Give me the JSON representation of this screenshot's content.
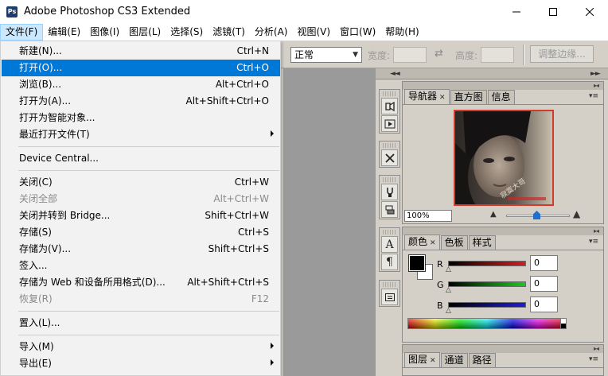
{
  "window": {
    "title": "Adobe Photoshop CS3 Extended",
    "icon_text": "Ps"
  },
  "menubar": {
    "items": [
      "文件(F)",
      "编辑(E)",
      "图像(I)",
      "图层(L)",
      "选择(S)",
      "滤镜(T)",
      "分析(A)",
      "视图(V)",
      "窗口(W)",
      "帮助(H)"
    ],
    "active_index": 0
  },
  "options": {
    "mode_value": "正常",
    "width_label": "宽度:",
    "height_label": "高度:",
    "refine_label": "调整边缘..."
  },
  "dock": {
    "left_arrows": "◄◄",
    "right_arrows": "►►"
  },
  "toolstrip": {
    "icons": [
      "history-brush-icon",
      "action-play-icon",
      "tools-icon",
      "clone-source-icon",
      "layer-comps-icon",
      "character-icon",
      "paragraph-icon",
      "notes-icon"
    ]
  },
  "navigator": {
    "tabs": [
      {
        "label": "导航器",
        "active": true,
        "closable": true
      },
      {
        "label": "直方图",
        "active": false,
        "closable": false
      },
      {
        "label": "信息",
        "active": false,
        "closable": false
      }
    ],
    "zoom": "100%",
    "thumb_watermark": "寂寞大哥"
  },
  "color_panel": {
    "tabs": [
      {
        "label": "颜色",
        "active": true,
        "closable": true
      },
      {
        "label": "色板",
        "active": false,
        "closable": false
      },
      {
        "label": "样式",
        "active": false,
        "closable": false
      }
    ],
    "channels": [
      {
        "label": "R",
        "value": "0",
        "color": "#d21e1e"
      },
      {
        "label": "G",
        "value": "0",
        "color": "#1ec81e"
      },
      {
        "label": "B",
        "value": "0",
        "color": "#1e1ed2"
      }
    ],
    "foreground": "#000000",
    "background": "#ffffff"
  },
  "layers_panel": {
    "tabs": [
      {
        "label": "图层",
        "active": true,
        "closable": true
      },
      {
        "label": "通道",
        "active": false,
        "closable": false
      },
      {
        "label": "路径",
        "active": false,
        "closable": false
      }
    ]
  },
  "file_menu": {
    "items": [
      {
        "label": "新建(N)...",
        "shortcut": "Ctrl+N",
        "enabled": true,
        "highlighted": false,
        "submenu": false
      },
      {
        "label": "打开(O)...",
        "shortcut": "Ctrl+O",
        "enabled": true,
        "highlighted": true,
        "submenu": false
      },
      {
        "label": "浏览(B)...",
        "shortcut": "Alt+Ctrl+O",
        "enabled": true,
        "highlighted": false,
        "submenu": false
      },
      {
        "label": "打开为(A)...",
        "shortcut": "Alt+Shift+Ctrl+O",
        "enabled": true,
        "highlighted": false,
        "submenu": false
      },
      {
        "label": "打开为智能对象...",
        "shortcut": "",
        "enabled": true,
        "highlighted": false,
        "submenu": false
      },
      {
        "label": "最近打开文件(T)",
        "shortcut": "",
        "enabled": true,
        "highlighted": false,
        "submenu": true
      },
      {
        "separator": true
      },
      {
        "label": "Device Central...",
        "shortcut": "",
        "enabled": true,
        "highlighted": false,
        "submenu": false
      },
      {
        "separator": true
      },
      {
        "label": "关闭(C)",
        "shortcut": "Ctrl+W",
        "enabled": true,
        "highlighted": false,
        "submenu": false
      },
      {
        "label": "关闭全部",
        "shortcut": "Alt+Ctrl+W",
        "enabled": false,
        "highlighted": false,
        "submenu": false
      },
      {
        "label": "关闭并转到 Bridge...",
        "shortcut": "Shift+Ctrl+W",
        "enabled": true,
        "highlighted": false,
        "submenu": false
      },
      {
        "label": "存储(S)",
        "shortcut": "Ctrl+S",
        "enabled": true,
        "highlighted": false,
        "submenu": false
      },
      {
        "label": "存储为(V)...",
        "shortcut": "Shift+Ctrl+S",
        "enabled": true,
        "highlighted": false,
        "submenu": false
      },
      {
        "label": "签入...",
        "shortcut": "",
        "enabled": true,
        "highlighted": false,
        "submenu": false
      },
      {
        "label": "存储为 Web 和设备所用格式(D)...",
        "shortcut": "Alt+Shift+Ctrl+S",
        "enabled": true,
        "highlighted": false,
        "submenu": false
      },
      {
        "label": "恢复(R)",
        "shortcut": "F12",
        "enabled": false,
        "highlighted": false,
        "submenu": false
      },
      {
        "separator": true
      },
      {
        "label": "置入(L)...",
        "shortcut": "",
        "enabled": true,
        "highlighted": false,
        "submenu": false
      },
      {
        "separator": true
      },
      {
        "label": "导入(M)",
        "shortcut": "",
        "enabled": true,
        "highlighted": false,
        "submenu": true
      },
      {
        "label": "导出(E)",
        "shortcut": "",
        "enabled": true,
        "highlighted": false,
        "submenu": true
      }
    ]
  }
}
